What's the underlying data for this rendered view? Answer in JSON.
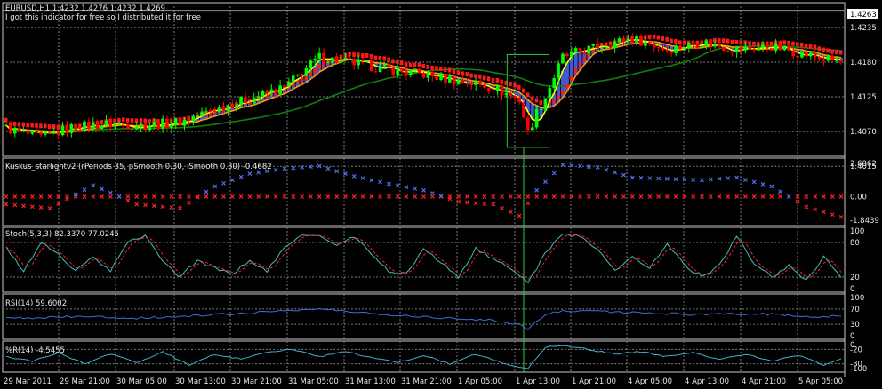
{
  "header": {
    "symbol_line": "EURUSD,H1  1.4232 1.4276 1.4232 1.4269",
    "note": "I got this indicator for free so I distributed it for free",
    "current_price_label": "1.4263"
  },
  "colors": {
    "background": "#000000",
    "frame": "#c8c8c8",
    "grid": "#7a7a7a",
    "bull_candle": "#00ff00",
    "bear_candle": "#ff0000",
    "blue_hist": "#3a5bd9",
    "yellow_ma": "#ffff00",
    "orange_ma": "#ff9900",
    "green_ma": "#0f7f0f",
    "red_band": "#ff1a1a",
    "kuskus_pos": "#4f6ff0",
    "kuskus_neg": "#ff2020",
    "stoch_main": "#40c0c0",
    "stoch_signal": "#ff2020",
    "rsi": "#3c6ee0",
    "wpr": "#40b0c8",
    "highlight": "#33cc33"
  },
  "panels": {
    "kuskus": {
      "label": "Kuskus_starlightv2  (rPeriods 35, pSmooth 0.30, iSmooth 0.30)  -0.4682"
    },
    "stoch": {
      "label": "Stoch(5,3,3) 82.3370 77.0245"
    },
    "rsi": {
      "label": "RSI(14) 59.6002"
    },
    "wpr": {
      "label": "%R(14) -4.5455"
    }
  },
  "chart_data": [
    {
      "type": "candlestick",
      "title": "EURUSD,H1",
      "ylim": [
        1.4035,
        1.427
      ],
      "y_ticks": [
        "1.4235",
        "1.4180",
        "1.4125",
        "1.4070",
        "1.4015"
      ],
      "x_ticks": [
        "29 Mar 2011",
        "29 Mar 21:00",
        "30 Mar 05:00",
        "30 Mar 13:00",
        "30 Mar 21:00",
        "31 Mar 05:00",
        "31 Mar 13:00",
        "31 Mar 21:00",
        "1 Apr 05:00",
        "1 Apr 13:00",
        "1 Apr 21:00",
        "4 Apr 05:00",
        "4 Apr 13:00",
        "4 Apr 21:00",
        "5 Apr 05:00"
      ],
      "close_path": [
        [
          0,
          1.4075
        ],
        [
          8,
          1.406
        ],
        [
          16,
          1.4078
        ],
        [
          24,
          1.4082
        ],
        [
          32,
          1.408
        ],
        [
          40,
          1.4085
        ],
        [
          48,
          1.4106
        ],
        [
          56,
          1.4122
        ],
        [
          64,
          1.414
        ],
        [
          72,
          1.4188
        ],
        [
          80,
          1.4178
        ],
        [
          88,
          1.4168
        ],
        [
          96,
          1.416
        ],
        [
          104,
          1.415
        ],
        [
          112,
          1.414
        ],
        [
          118,
          1.412
        ],
        [
          120,
          1.4068
        ],
        [
          122,
          1.41
        ],
        [
          124,
          1.4125
        ],
        [
          128,
          1.4188
        ],
        [
          136,
          1.4205
        ],
        [
          144,
          1.4218
        ],
        [
          152,
          1.42
        ],
        [
          160,
          1.4212
        ],
        [
          168,
          1.42
        ],
        [
          176,
          1.4205
        ],
        [
          184,
          1.4192
        ],
        [
          188,
          1.4185
        ],
        [
          192,
          1.418
        ]
      ]
    },
    {
      "type": "scatter",
      "name": "Kuskus_starlightv2",
      "ylim": [
        -1.8439,
        2.6062
      ],
      "y_ticks": [
        "2.6062",
        "0.00",
        "-1.8439"
      ],
      "values": [
        [
          0,
          -0.6
        ],
        [
          10,
          -0.9
        ],
        [
          20,
          0.9
        ],
        [
          30,
          -0.6
        ],
        [
          40,
          -0.9
        ],
        [
          48,
          0.8
        ],
        [
          56,
          1.8
        ],
        [
          64,
          2.2
        ],
        [
          72,
          2.4
        ],
        [
          80,
          1.6
        ],
        [
          88,
          1.0
        ],
        [
          96,
          0.5
        ],
        [
          104,
          -0.4
        ],
        [
          112,
          -0.6
        ],
        [
          118,
          -1.5
        ],
        [
          122,
          0.5
        ],
        [
          128,
          2.5
        ],
        [
          136,
          2.3
        ],
        [
          144,
          1.5
        ],
        [
          152,
          1.4
        ],
        [
          160,
          1.3
        ],
        [
          168,
          1.5
        ],
        [
          176,
          0.8
        ],
        [
          184,
          -0.8
        ],
        [
          192,
          -1.6
        ]
      ]
    },
    {
      "type": "line",
      "name": "Stoch(5,3,3)",
      "ylim": [
        0,
        100
      ],
      "y_ticks": [
        "100",
        "80",
        "20",
        "0"
      ],
      "levels": [
        20,
        80
      ],
      "values": [
        [
          0,
          70
        ],
        [
          4,
          30
        ],
        [
          8,
          80
        ],
        [
          12,
          60
        ],
        [
          16,
          30
        ],
        [
          20,
          55
        ],
        [
          24,
          30
        ],
        [
          28,
          82
        ],
        [
          32,
          90
        ],
        [
          36,
          50
        ],
        [
          40,
          20
        ],
        [
          44,
          50
        ],
        [
          48,
          35
        ],
        [
          52,
          25
        ],
        [
          56,
          50
        ],
        [
          60,
          30
        ],
        [
          64,
          70
        ],
        [
          68,
          95
        ],
        [
          72,
          90
        ],
        [
          76,
          75
        ],
        [
          80,
          90
        ],
        [
          84,
          60
        ],
        [
          88,
          30
        ],
        [
          92,
          25
        ],
        [
          96,
          70
        ],
        [
          100,
          45
        ],
        [
          104,
          20
        ],
        [
          108,
          70
        ],
        [
          112,
          50
        ],
        [
          116,
          35
        ],
        [
          120,
          12
        ],
        [
          124,
          60
        ],
        [
          128,
          96
        ],
        [
          132,
          90
        ],
        [
          136,
          70
        ],
        [
          140,
          30
        ],
        [
          144,
          55
        ],
        [
          148,
          35
        ],
        [
          152,
          80
        ],
        [
          156,
          40
        ],
        [
          160,
          20
        ],
        [
          164,
          40
        ],
        [
          168,
          90
        ],
        [
          172,
          45
        ],
        [
          176,
          20
        ],
        [
          180,
          40
        ],
        [
          184,
          15
        ],
        [
          188,
          55
        ],
        [
          192,
          20
        ]
      ]
    },
    {
      "type": "line",
      "name": "RSI(14)",
      "ylim": [
        0,
        100
      ],
      "y_ticks": [
        "100",
        "70",
        "30",
        "0"
      ],
      "levels": [
        30,
        70
      ],
      "values": [
        [
          0,
          45
        ],
        [
          10,
          48
        ],
        [
          20,
          50
        ],
        [
          30,
          46
        ],
        [
          40,
          50
        ],
        [
          48,
          55
        ],
        [
          56,
          60
        ],
        [
          64,
          66
        ],
        [
          72,
          70
        ],
        [
          80,
          62
        ],
        [
          88,
          55
        ],
        [
          96,
          50
        ],
        [
          104,
          45
        ],
        [
          112,
          40
        ],
        [
          118,
          30
        ],
        [
          120,
          18
        ],
        [
          124,
          55
        ],
        [
          128,
          66
        ],
        [
          136,
          65
        ],
        [
          144,
          60
        ],
        [
          152,
          58
        ],
        [
          160,
          55
        ],
        [
          168,
          58
        ],
        [
          176,
          56
        ],
        [
          184,
          50
        ],
        [
          192,
          52
        ]
      ]
    },
    {
      "type": "line",
      "name": "%R(14)",
      "ylim": [
        -100,
        0
      ],
      "y_ticks": [
        "0",
        "-20",
        "-80",
        "-100"
      ],
      "levels": [
        -20,
        -80
      ],
      "values": [
        [
          0,
          -50
        ],
        [
          6,
          -70
        ],
        [
          12,
          -35
        ],
        [
          18,
          -80
        ],
        [
          24,
          -40
        ],
        [
          30,
          -75
        ],
        [
          36,
          -30
        ],
        [
          42,
          -85
        ],
        [
          48,
          -40
        ],
        [
          54,
          -60
        ],
        [
          60,
          -30
        ],
        [
          66,
          -20
        ],
        [
          72,
          -50
        ],
        [
          78,
          -30
        ],
        [
          84,
          -55
        ],
        [
          90,
          -75
        ],
        [
          96,
          -45
        ],
        [
          102,
          -80
        ],
        [
          108,
          -40
        ],
        [
          114,
          -75
        ],
        [
          118,
          -95
        ],
        [
          120,
          -100
        ],
        [
          124,
          -10
        ],
        [
          128,
          -5
        ],
        [
          134,
          -20
        ],
        [
          140,
          -40
        ],
        [
          146,
          -30
        ],
        [
          152,
          -50
        ],
        [
          158,
          -35
        ],
        [
          164,
          -60
        ],
        [
          170,
          -40
        ],
        [
          176,
          -70
        ],
        [
          182,
          -45
        ],
        [
          188,
          -85
        ],
        [
          192,
          -60
        ]
      ]
    }
  ]
}
